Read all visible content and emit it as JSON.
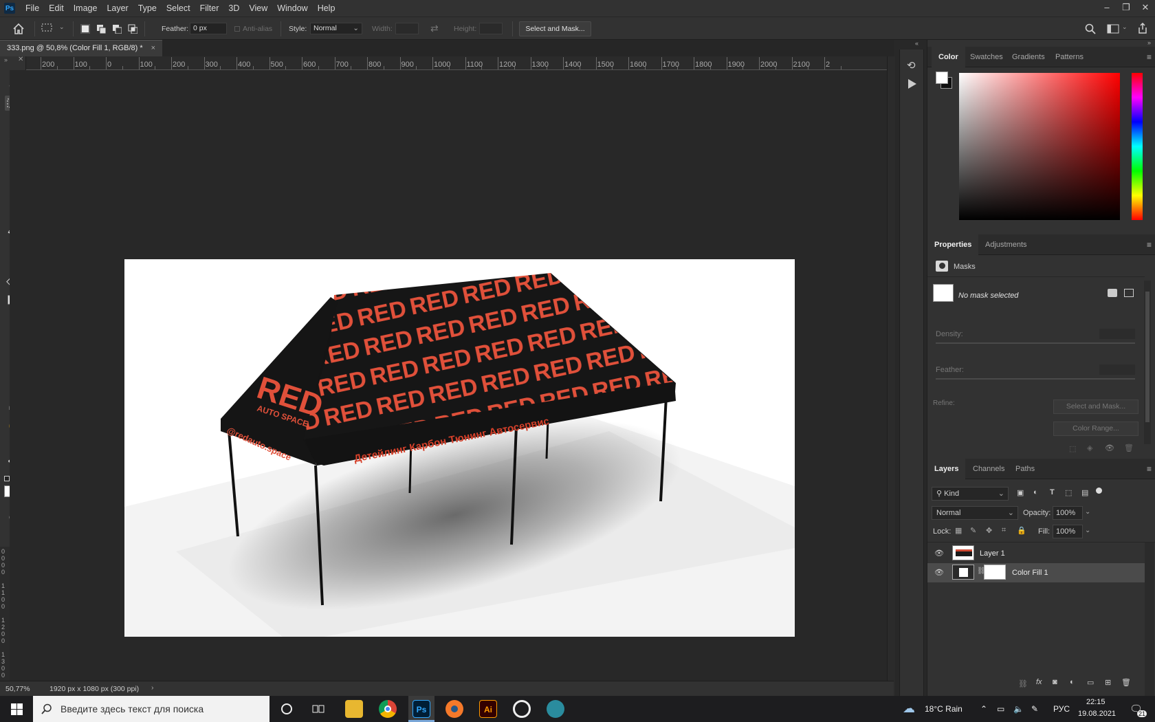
{
  "app": {
    "logo": "Ps"
  },
  "menu": [
    "File",
    "Edit",
    "Image",
    "Layer",
    "Type",
    "Select",
    "Filter",
    "3D",
    "View",
    "Window",
    "Help"
  ],
  "options": {
    "feather_label": "Feather:",
    "feather_value": "0 px",
    "antialias_label": "Anti-alias",
    "style_label": "Style:",
    "style_value": "Normal",
    "width_label": "Width:",
    "height_label": "Height:",
    "select_mask_button": "Select and Mask..."
  },
  "document": {
    "tab_title": "333.png @ 50,8% (Color Fill 1, RGB/8) *",
    "close": "×"
  },
  "ruler": [
    "200",
    "100",
    "0",
    "100",
    "200",
    "300",
    "400",
    "500",
    "600",
    "700",
    "800",
    "900",
    "1000",
    "1100",
    "1200",
    "1300",
    "1400",
    "1500",
    "1600",
    "1700",
    "1800",
    "1900",
    "2000",
    "2100",
    "2"
  ],
  "status": {
    "zoom": "50,77%",
    "doc_info": "1920 px x 1080 px (300 ppi)"
  },
  "color_panel": {
    "tabs": [
      "Color",
      "Swatches",
      "Gradients",
      "Patterns"
    ],
    "active": "Color"
  },
  "properties_panel": {
    "tabs": [
      "Properties",
      "Adjustments"
    ],
    "section": "Masks",
    "no_mask": "No mask selected",
    "density_label": "Density:",
    "feather_label": "Feather:",
    "refine_label": "Refine:",
    "select_mask_button": "Select and Mask...",
    "color_range_button": "Color Range..."
  },
  "layers_panel": {
    "tabs": [
      "Layers",
      "Channels",
      "Paths"
    ],
    "filter_kind": "Kind",
    "blend_mode": "Normal",
    "opacity_label": "Opacity:",
    "opacity_value": "100%",
    "lock_label": "Lock:",
    "fill_label": "Fill:",
    "fill_value": "100%",
    "layers": [
      {
        "name": "Layer 1",
        "selected": false
      },
      {
        "name": "Color Fill 1",
        "selected": true
      }
    ]
  },
  "artwork": {
    "brand": "RED",
    "brand_sub": "AUTO SPACE",
    "website": "@redauto.space",
    "services": "Детейлинг  Карбон  Тюнинг  Автосервис",
    "pattern": "RED"
  },
  "taskbar": {
    "search_placeholder": "Введите здесь текст для поиска",
    "weather": "18°C  Rain",
    "lang": "РУС",
    "time": "22:15",
    "date": "19.08.2021",
    "notifications": "21",
    "apps": [
      "cortana",
      "task-view",
      "file-explorer",
      "chrome",
      "photoshop",
      "blender",
      "illustrator",
      "app-circle",
      "app-bird"
    ]
  },
  "colors": {
    "accent_red": "#e0503a",
    "tent_black": "#141414"
  }
}
